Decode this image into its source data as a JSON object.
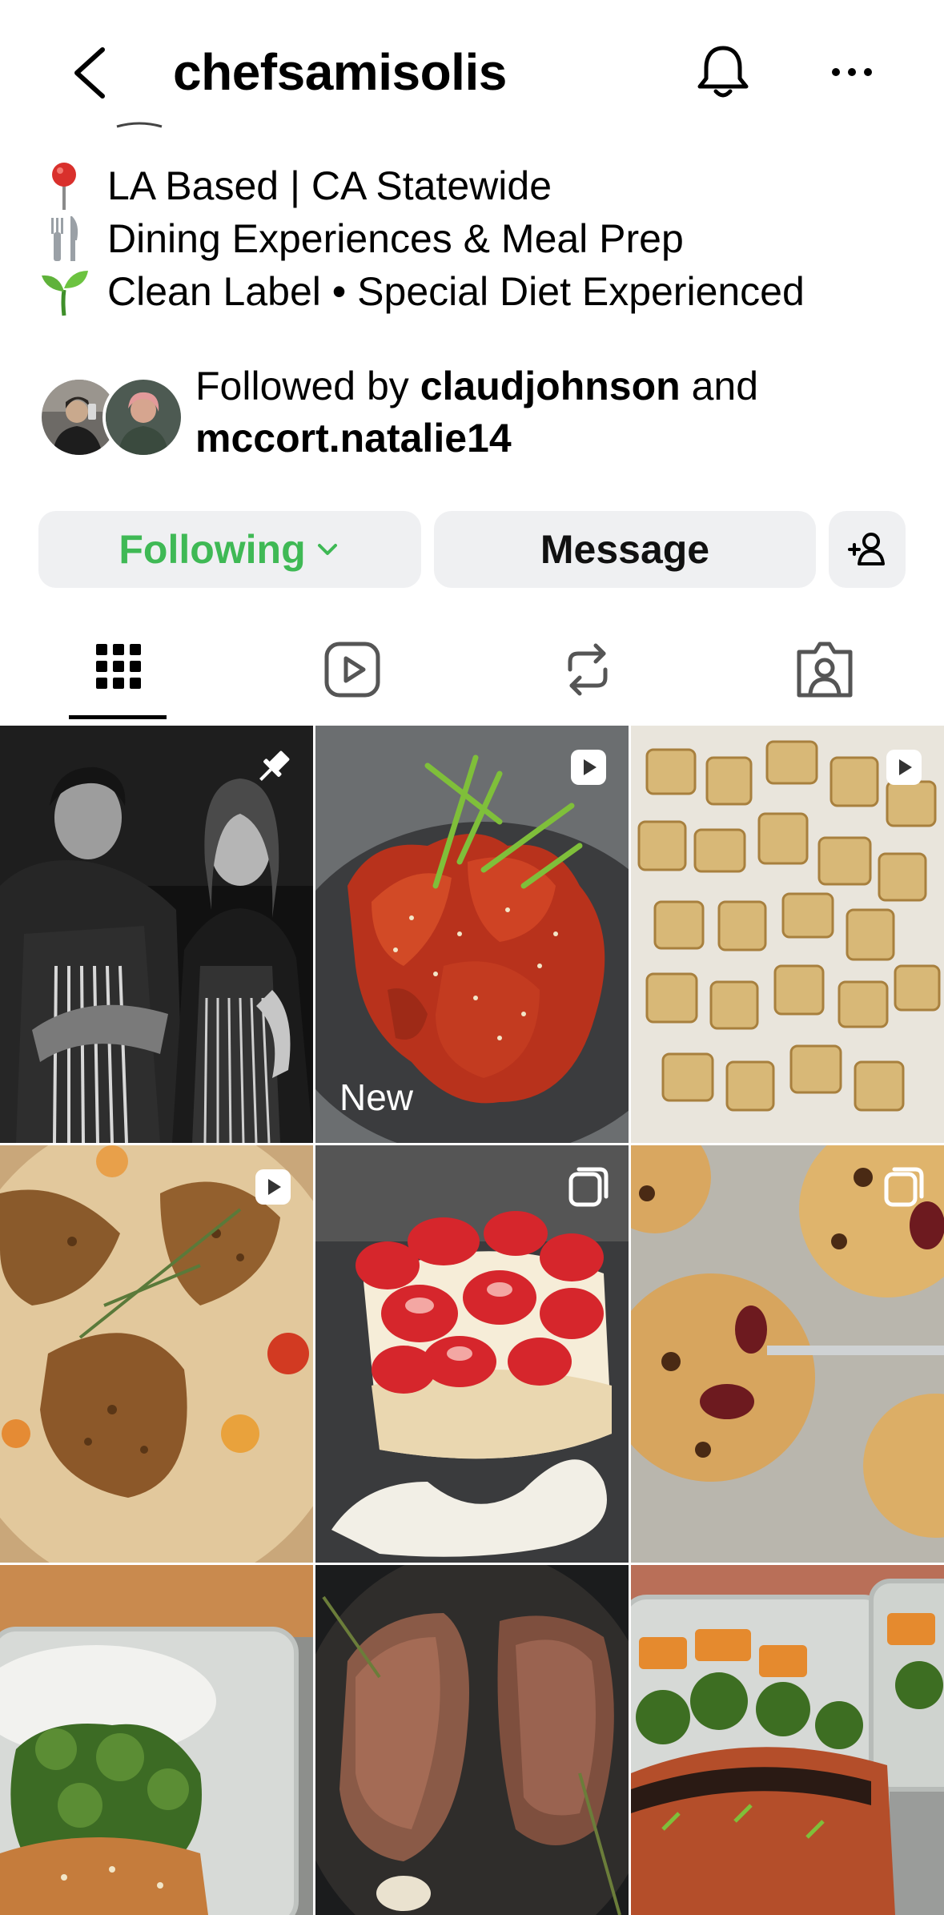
{
  "header": {
    "username": "chefsamisolis",
    "back_icon": "chevron-left-icon",
    "notifications_icon": "bell-icon",
    "more_icon": "more-horizontal-icon"
  },
  "bio": {
    "lines": [
      {
        "icon": "round-pushpin-emoji",
        "text": "LA Based | CA Statewide"
      },
      {
        "icon": "fork-and-knife-emoji",
        "text": "Dining Experiences & Meal Prep"
      },
      {
        "icon": "seedling-emoji",
        "text": "Clean Label • Special Diet Experienced"
      }
    ]
  },
  "followed_by": {
    "prefix": "Followed by ",
    "user1": "claudjohnson",
    "connector": " and",
    "user2": "mccort.natalie14"
  },
  "actions": {
    "following_label": "Following",
    "message_label": "Message",
    "add_icon": "add-person-icon"
  },
  "tabs": [
    {
      "name": "posts",
      "icon": "grid-icon",
      "active": true
    },
    {
      "name": "reels",
      "icon": "reels-icon",
      "active": false
    },
    {
      "name": "reposts",
      "icon": "repost-icon",
      "active": false
    },
    {
      "name": "tagged",
      "icon": "tagged-person-icon",
      "active": false
    }
  ],
  "grid": [
    {
      "subject": "chefs portrait",
      "badge": "pin-icon"
    },
    {
      "subject": "glazed chicken wings",
      "badge": "reel-icon",
      "label": "New"
    },
    {
      "subject": "croutons",
      "badge": "reel-icon"
    },
    {
      "subject": "chicken in cream sauce",
      "badge": "reel-icon"
    },
    {
      "subject": "strawberry cake",
      "badge": "carousel-icon"
    },
    {
      "subject": "chocolate cherry cookies",
      "badge": "carousel-icon"
    },
    {
      "subject": "meal prep chicken broccoli rice"
    },
    {
      "subject": "seared steak"
    },
    {
      "subject": "meal prep salmon sweet potato"
    }
  ],
  "colors": {
    "following_text": "#3fb955",
    "button_bg": "#eff0f2"
  }
}
